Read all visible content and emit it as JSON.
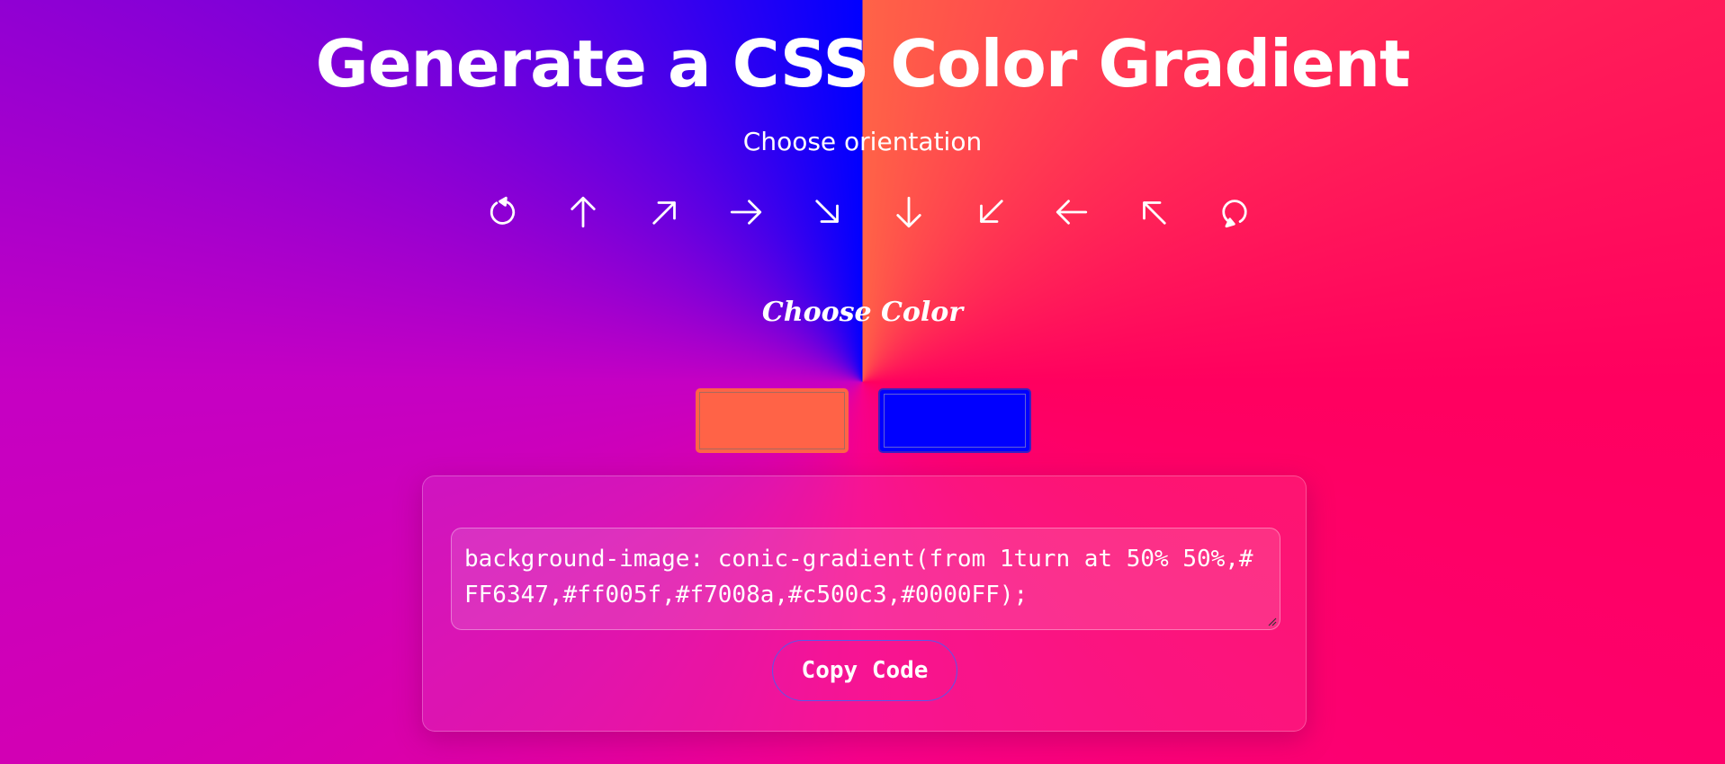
{
  "header": {
    "title": "Generate a CSS Color Gradient",
    "subtitle": "Choose orientation"
  },
  "orientation": {
    "options": [
      {
        "icon": "rotate-counterclockwise-icon"
      },
      {
        "icon": "arrow-up-icon"
      },
      {
        "icon": "arrow-up-right-icon"
      },
      {
        "icon": "arrow-right-icon"
      },
      {
        "icon": "arrow-down-right-icon"
      },
      {
        "icon": "arrow-down-icon"
      },
      {
        "icon": "arrow-down-left-icon"
      },
      {
        "icon": "arrow-left-icon"
      },
      {
        "icon": "arrow-up-left-icon"
      },
      {
        "icon": "rotate-clockwise-icon"
      }
    ]
  },
  "colors": {
    "label": "Choose Color",
    "color_1": "#FF6347",
    "color_2": "#0000FF"
  },
  "output": {
    "code": "background-image: conic-gradient(from 1turn at 50% 50%,#FF6347,#ff005f,#f7008a,#c500c3,#0000FF);",
    "copy_label": "Copy Code"
  },
  "theme": {
    "text": "#ffffff",
    "copy_border": "#5b57e8"
  }
}
